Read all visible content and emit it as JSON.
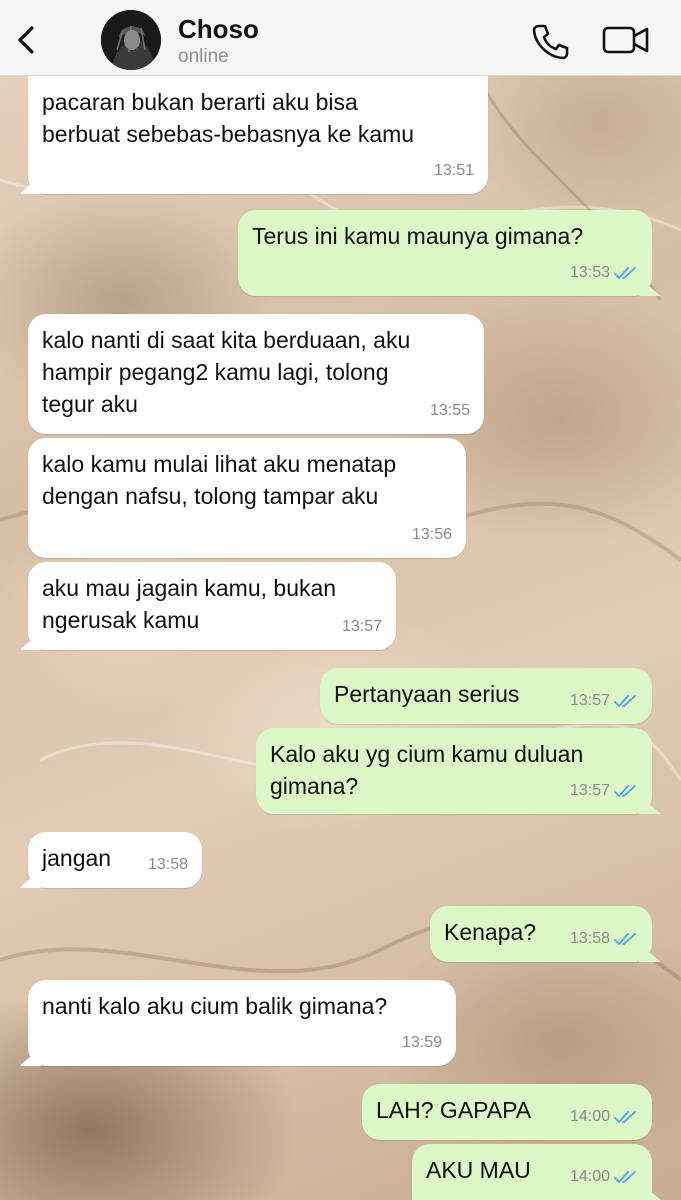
{
  "header": {
    "contact_name": "Choso",
    "status": "online",
    "icons": {
      "back": "chevron-left-icon",
      "call": "phone-icon",
      "video": "video-camera-icon"
    }
  },
  "colors": {
    "incoming_bubble": "#ffffff",
    "outgoing_bubble": "#dcf8c6",
    "read_ticks": "#4fa3e0",
    "header_bg": "#f6f6f6"
  },
  "messages": [
    {
      "direction": "in",
      "text": "pacaran bukan berarti aku bisa\nberbuat sebebas-bebasnya ke kamu",
      "time": "13:51"
    },
    {
      "direction": "out",
      "text": "Terus ini kamu maunya gimana?",
      "time": "13:53",
      "status": "read"
    },
    {
      "direction": "in",
      "text": "kalo nanti di saat kita berduaan, aku\nhampir pegang2 kamu lagi, tolong\ntegur aku",
      "time": "13:55"
    },
    {
      "direction": "in",
      "text": "kalo kamu mulai lihat aku menatap\ndengan nafsu, tolong tampar aku",
      "time": "13:56"
    },
    {
      "direction": "in",
      "text": "aku mau jagain kamu, bukan\nngerusak kamu",
      "time": "13:57"
    },
    {
      "direction": "out",
      "text": "Pertanyaan serius",
      "time": "13:57",
      "status": "read"
    },
    {
      "direction": "out",
      "text": "Kalo aku yg cium kamu duluan\ngimana?",
      "time": "13:57",
      "status": "read"
    },
    {
      "direction": "in",
      "text": "jangan",
      "time": "13:58"
    },
    {
      "direction": "out",
      "text": "Kenapa?",
      "time": "13:58",
      "status": "read"
    },
    {
      "direction": "in",
      "text": "nanti kalo aku cium balik gimana?",
      "time": "13:59"
    },
    {
      "direction": "out",
      "text": "LAH? GAPAPA",
      "time": "14:00",
      "status": "read"
    },
    {
      "direction": "out",
      "text": "AKU MAU",
      "time": "14:00",
      "status": "read"
    }
  ]
}
